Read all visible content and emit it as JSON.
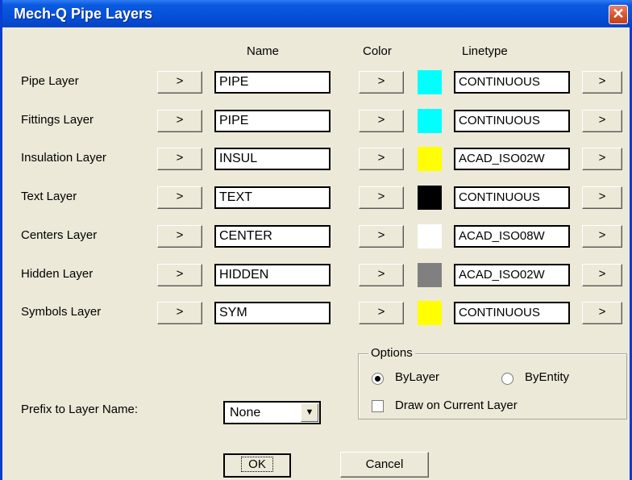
{
  "window": {
    "title": "Mech-Q Pipe Layers",
    "close_glyph": "✕"
  },
  "headers": {
    "name": "Name",
    "color": "Color",
    "linetype": "Linetype"
  },
  "arrow_label": ">",
  "rows": [
    {
      "label": "Pipe Layer",
      "name": "PIPE",
      "color": "#00ffff",
      "linetype": "CONTINUOUS"
    },
    {
      "label": "Fittings Layer",
      "name": "PIPE",
      "color": "#00ffff",
      "linetype": "CONTINUOUS"
    },
    {
      "label": "Insulation Layer",
      "name": "INSUL",
      "color": "#ffff00",
      "linetype": "ACAD_ISO02W"
    },
    {
      "label": "Text Layer",
      "name": "TEXT",
      "color": "#000000",
      "linetype": "CONTINUOUS"
    },
    {
      "label": "Centers Layer",
      "name": "CENTER",
      "color": "#ffffff",
      "linetype": "ACAD_ISO08W"
    },
    {
      "label": "Hidden Layer",
      "name": "HIDDEN",
      "color": "#808080",
      "linetype": "ACAD_ISO02W"
    },
    {
      "label": "Symbols Layer",
      "name": "SYM",
      "color": "#ffff00",
      "linetype": "CONTINUOUS"
    }
  ],
  "options": {
    "title": "Options",
    "bylayer_label": "ByLayer",
    "byentity_label": "ByEntity",
    "selected": "ByLayer",
    "draw_current_label": "Draw on Current Layer",
    "draw_current_checked": false
  },
  "prefix": {
    "label": "Prefix to Layer Name:",
    "value": "None",
    "arrow": "▼"
  },
  "buttons": {
    "ok": "OK",
    "cancel": "Cancel"
  }
}
